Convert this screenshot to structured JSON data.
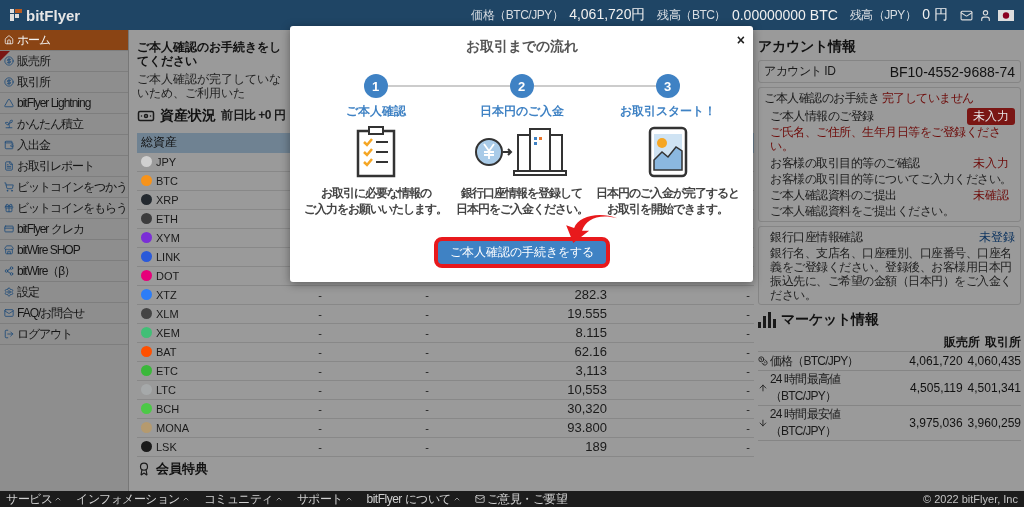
{
  "header": {
    "logo": "bitFlyer",
    "stats": [
      {
        "label": "価格（BTC/JPY）",
        "value": "4,061,720円"
      },
      {
        "label": "残高（BTC）",
        "value": "0.00000000 BTC"
      },
      {
        "label": "残高（JPY）",
        "value": "0 円"
      }
    ]
  },
  "sidebar": {
    "items": [
      {
        "label": "ホーム",
        "selected": true
      },
      {
        "label": "販売所",
        "selected": false
      },
      {
        "label": "取引所",
        "selected": false
      },
      {
        "label": "bitFlyer Lightning",
        "selected": false
      },
      {
        "label": "かんたん積立",
        "selected": false
      },
      {
        "label": "入出金",
        "selected": false
      },
      {
        "label": "お取引レポート",
        "selected": false
      },
      {
        "label": "ビットコインをつかう",
        "selected": false
      },
      {
        "label": "ビットコインをもらう",
        "selected": false
      },
      {
        "label": "bitFlyer クレカ",
        "selected": false
      },
      {
        "label": "bitWire SHOP",
        "selected": false
      },
      {
        "label": "bitWire（β）",
        "selected": false
      },
      {
        "label": "設定",
        "selected": false
      },
      {
        "label": "FAQ/お問合せ",
        "selected": false
      },
      {
        "label": "ログアウト",
        "selected": false
      }
    ]
  },
  "notice": {
    "title": "ご本人確認のお手続きをしてください",
    "text": "ご本人確認が完了していないため、ご利用いた"
  },
  "assets": {
    "title": "資産状況",
    "change": "前日比 +0 円",
    "header": "総資産",
    "rows": [
      {
        "name": "JPY",
        "color": "#d0d0d0",
        "cells": []
      },
      {
        "name": "BTC",
        "color": "#f7931a",
        "cells": []
      },
      {
        "name": "XRP",
        "color": "#23292f",
        "cells": []
      },
      {
        "name": "ETH",
        "color": "#3c3c3d",
        "cells": []
      },
      {
        "name": "XYM",
        "color": "#7b2fd6",
        "cells": []
      },
      {
        "name": "LINK",
        "color": "#2a5ada",
        "cells": []
      },
      {
        "name": "DOT",
        "color": "#e6007a",
        "cells": []
      },
      {
        "name": "XTZ",
        "color": "#2c7df7",
        "cells": [
          "-",
          "-",
          "282.3",
          "-"
        ]
      },
      {
        "name": "XLM",
        "color": "#444444",
        "cells": [
          "-",
          "-",
          "19.555",
          "-"
        ]
      },
      {
        "name": "XEM",
        "color": "#41bf76",
        "cells": [
          "-",
          "-",
          "8.115",
          "-"
        ]
      },
      {
        "name": "BAT",
        "color": "#ff5000",
        "cells": [
          "-",
          "-",
          "62.16",
          "-"
        ]
      },
      {
        "name": "ETC",
        "color": "#3ab83a",
        "cells": [
          "-",
          "-",
          "3,113",
          "-"
        ]
      },
      {
        "name": "LTC",
        "color": "#a6a9aa",
        "cells": [
          "-",
          "-",
          "10,553",
          "-"
        ]
      },
      {
        "name": "BCH",
        "color": "#4cc947",
        "cells": [
          "-",
          "-",
          "30,320",
          "-"
        ]
      },
      {
        "name": "MONA",
        "color": "#b59a6e",
        "cells": [
          "-",
          "-",
          "93.800",
          "-"
        ]
      },
      {
        "name": "LSK",
        "color": "#1a1a1a",
        "cells": [
          "-",
          "-",
          "189",
          "-"
        ]
      }
    ]
  },
  "perks": {
    "title": "会員特典"
  },
  "account": {
    "title": "アカウント情報",
    "id_label": "アカウント ID",
    "id_value": "BF10-4552-9688-74",
    "verification": {
      "label": "ご本人確認のお手続き",
      "status": "完了していません",
      "items": [
        {
          "title": "ご本人情報のご登録",
          "status": "未入力",
          "kind": "badge",
          "note": "ご氏名、ご住所、生年月日等をご登録ください。",
          "alert": true
        },
        {
          "title": "お客様の取引目的等のご確認",
          "status": "未入力",
          "kind": "text",
          "note": "お客様の取引目的等についてご入力ください。",
          "alert": false
        },
        {
          "title": "ご本人確認資料のご提出",
          "status": "未確認",
          "kind": "text",
          "note": "ご本人確認資料をご提出ください。",
          "alert": false
        }
      ]
    },
    "bank": {
      "title": "銀行口座情報確認",
      "status": "未登録",
      "note": "銀行名、支店名、口座種別、口座番号、口座名義をご登録ください。登録後、お客様用日本円振込先に、ご希望の金額（日本円）をご入金ください。"
    }
  },
  "market": {
    "title": "マーケット情報",
    "columns": [
      "販売所",
      "取引所"
    ],
    "rows": [
      {
        "label": "価格（BTC/JPY）",
        "values": [
          "4,061,720",
          "4,060,435"
        ]
      },
      {
        "label": "24 時間最高値（BTC/JPY）",
        "values": [
          "4,505,119",
          "4,501,341"
        ]
      },
      {
        "label": "24 時間最安値（BTC/JPY）",
        "values": [
          "3,975,036",
          "3,960,259"
        ]
      }
    ]
  },
  "footer": {
    "menus": [
      "サービス",
      "インフォメーション",
      "コミュニティ",
      "サポート",
      "bitFlyer について"
    ],
    "feedback": "ご意見・ご要望",
    "copyright": "© 2022 bitFlyer, Inc"
  },
  "modal": {
    "title": "お取引までの流れ",
    "close": "×",
    "steps": [
      {
        "number": "1",
        "title": "ご本人確認",
        "lines": [
          "お取引に必要な情報の",
          "ご入力をお願いいたします。"
        ]
      },
      {
        "number": "2",
        "title": "日本円のご入金",
        "lines": [
          "銀行口座情報を登録して",
          "日本円をご入金ください。"
        ]
      },
      {
        "number": "3",
        "title": "お取引スタート！",
        "lines": [
          "日本円のご入金が完了すると",
          "お取引を開始できます。"
        ]
      }
    ],
    "button": "ご本人確認の手続きをする"
  }
}
